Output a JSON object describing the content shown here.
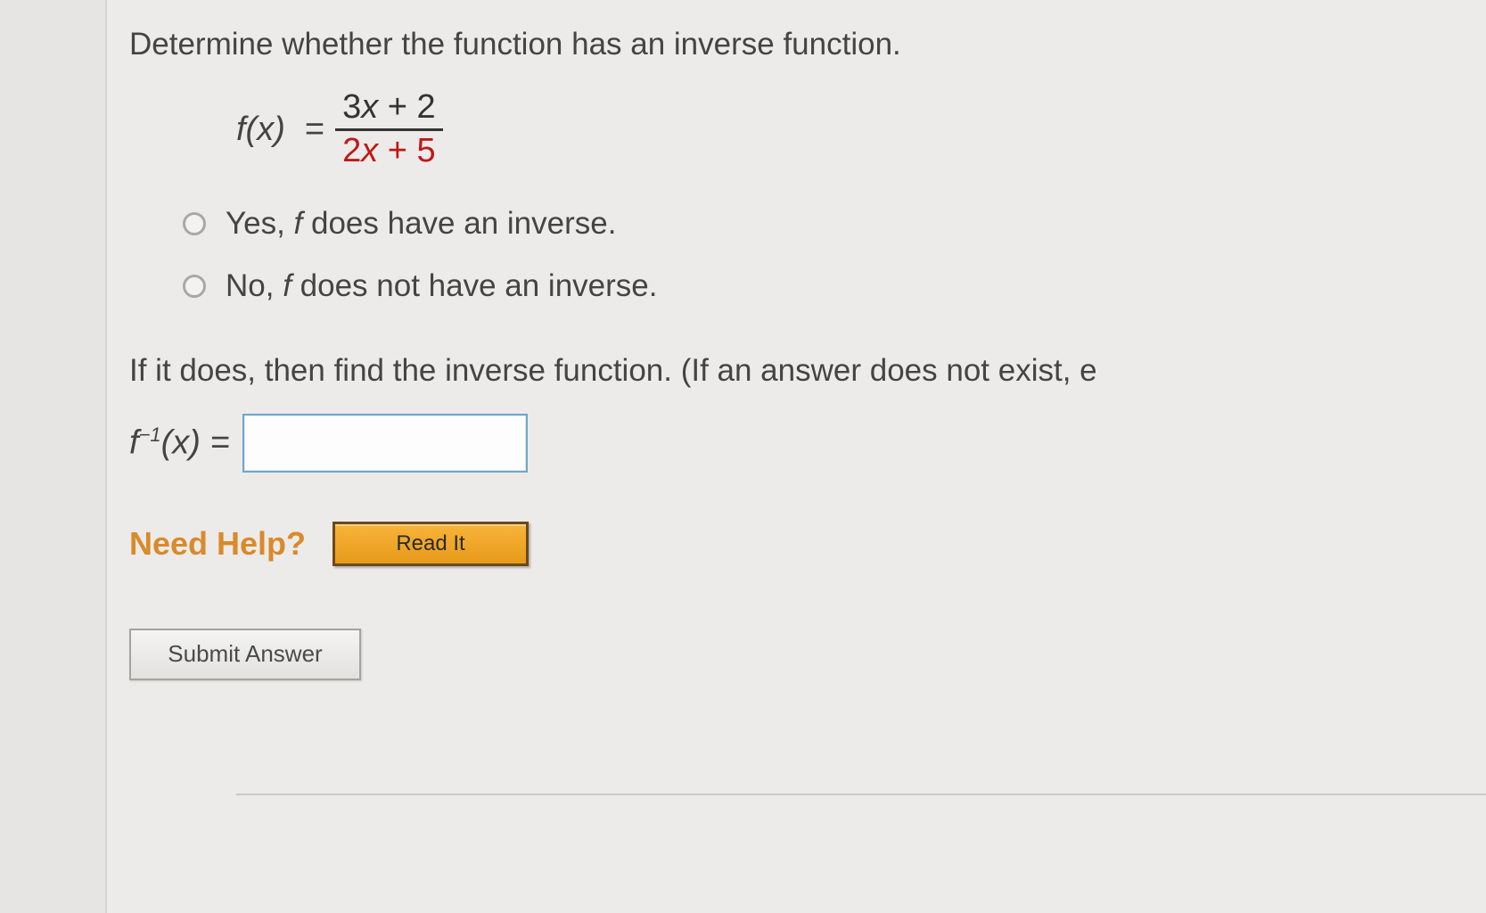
{
  "question": {
    "prompt1": "Determine whether the function has an inverse function.",
    "formula": {
      "lhs": "f(x)",
      "eq": "=",
      "numerator": "3x + 2",
      "denominator": "2x + 5"
    },
    "options": [
      {
        "prefix": "Yes, ",
        "fn": "f",
        "rest": " does have an inverse."
      },
      {
        "prefix": "No, ",
        "fn": "f",
        "rest": " does not have an inverse."
      }
    ],
    "prompt2": "If it does, then find the inverse function. (If an answer does not exist, e",
    "inverse_label_pre": "f",
    "inverse_label_sup": "−1",
    "inverse_label_post": "(x) = ",
    "answer_value": ""
  },
  "help": {
    "label": "Need Help?",
    "read_it": "Read It"
  },
  "buttons": {
    "submit": "Submit Answer"
  }
}
